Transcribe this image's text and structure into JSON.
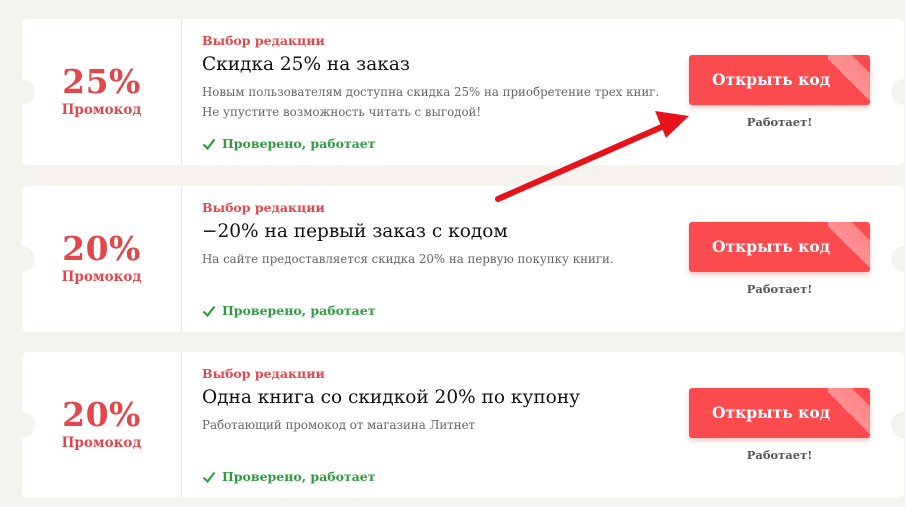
{
  "coupons": [
    {
      "percent": "25%",
      "promo_label": "Промокод",
      "editor_label": "Выбор редакции",
      "title": "Скидка 25% на заказ",
      "description": "Новым пользователям доступна скидка 25% на приобретение трех книг. Не упустите возможность читать с выгодой!",
      "verified": "Проверено, работает",
      "button_label": "Открыть код",
      "status": "Работает!"
    },
    {
      "percent": "20%",
      "promo_label": "Промокод",
      "editor_label": "Выбор редакции",
      "title": "−20% на первый заказ с кодом",
      "description": "На сайте предоставляется скидка 20% на первую покупку книги.",
      "verified": "Проверено, работает",
      "button_label": "Открыть код",
      "status": "Работает!"
    },
    {
      "percent": "20%",
      "promo_label": "Промокод",
      "editor_label": "Выбор редакции",
      "title": "Одна книга со скидкой 20% по купону",
      "description": "Работающий промокод от магазина Литнет",
      "verified": "Проверено, работает",
      "button_label": "Открыть код",
      "status": "Работает!"
    }
  ],
  "colors": {
    "accent": "#e2474b",
    "button": "#fb4b4f",
    "verified": "#2f9c3e",
    "page_bg": "#f5f3ee",
    "annotation_arrow": "#e8121b"
  },
  "icons": {
    "verified": "check-icon",
    "annotation": "red-arrow-pointer"
  }
}
